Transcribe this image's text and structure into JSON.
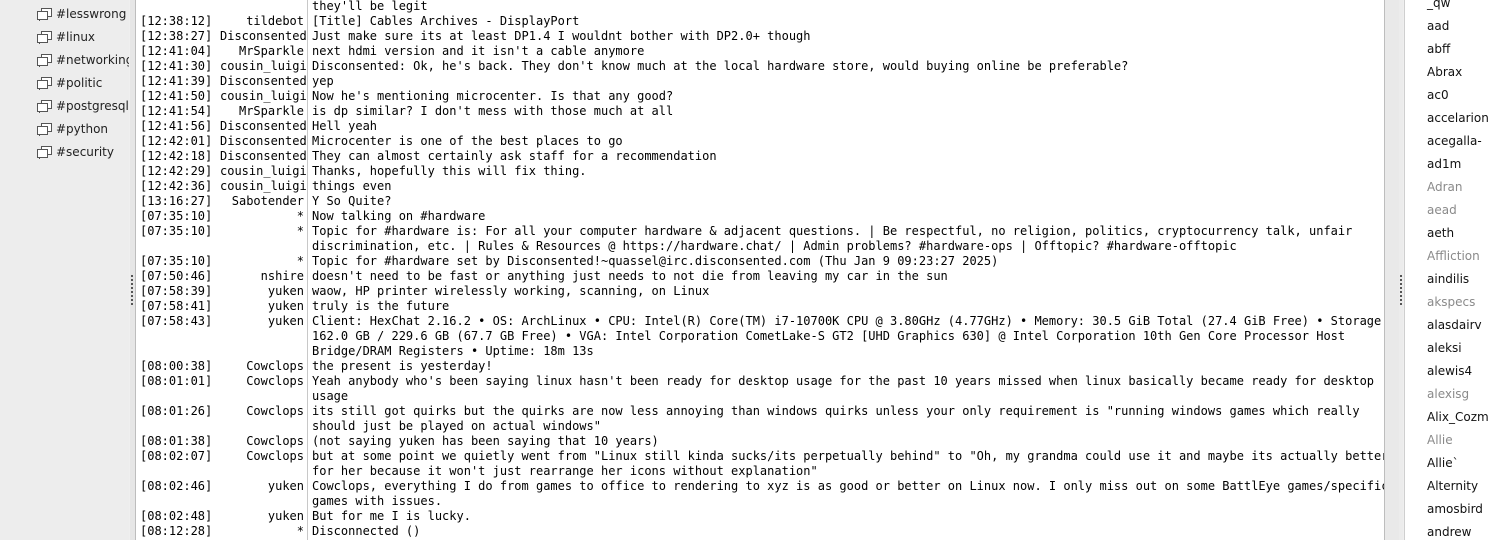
{
  "sidebar": {
    "channels": [
      {
        "name": "#lesswrong"
      },
      {
        "name": "#linux"
      },
      {
        "name": "#networking"
      },
      {
        "name": "#politic"
      },
      {
        "name": "#postgresql"
      },
      {
        "name": "#python"
      },
      {
        "name": "#security"
      }
    ]
  },
  "chat": {
    "lines": [
      {
        "time": "",
        "nick": "",
        "lines": [
          "they'll be legit"
        ]
      },
      {
        "time": "[12:38:12]",
        "nick": "tildebot",
        "lines": [
          "[Title] Cables Archives - DisplayPort"
        ]
      },
      {
        "time": "[12:38:27]",
        "nick": "Disconsented",
        "lines": [
          "Just make sure its at least DP1.4 I wouldnt bother with DP2.0+ though"
        ]
      },
      {
        "time": "[12:41:04]",
        "nick": "MrSparkle",
        "lines": [
          "next hdmi version and it isn't a cable anymore"
        ]
      },
      {
        "time": "[12:41:30]",
        "nick": "cousin_luigi",
        "lines": [
          "Disconsented: Ok, he's back. They don't know much at the local hardware store, would buying online be preferable?"
        ]
      },
      {
        "time": "[12:41:39]",
        "nick": "Disconsented",
        "lines": [
          "yep"
        ]
      },
      {
        "time": "[12:41:50]",
        "nick": "cousin_luigi",
        "lines": [
          "Now he's mentioning microcenter. Is that any good?"
        ]
      },
      {
        "time": "[12:41:54]",
        "nick": "MrSparkle",
        "lines": [
          "is dp similar? I don't mess with those much at all"
        ]
      },
      {
        "time": "[12:41:56]",
        "nick": "Disconsented",
        "lines": [
          "Hell yeah"
        ]
      },
      {
        "time": "[12:42:01]",
        "nick": "Disconsented",
        "lines": [
          "Microcenter is one of the best places to go"
        ]
      },
      {
        "time": "[12:42:18]",
        "nick": "Disconsented",
        "lines": [
          "They can almost certainly ask staff for a recommendation"
        ]
      },
      {
        "time": "[12:42:29]",
        "nick": "cousin_luigi",
        "lines": [
          "Thanks, hopefully this will fix thing."
        ]
      },
      {
        "time": "[12:42:36]",
        "nick": "cousin_luigi",
        "lines": [
          "things even"
        ]
      },
      {
        "time": "[13:16:27]",
        "nick": "Sabotender",
        "lines": [
          "Y So Quite?"
        ]
      },
      {
        "time": "[07:35:10]",
        "nick": "*",
        "lines": [
          "Now talking on #hardware"
        ]
      },
      {
        "time": "[07:35:10]",
        "nick": "*",
        "lines": [
          "Topic for #hardware is: For all your computer hardware & adjacent questions. | Be respectful, no religion, politics, cryptocurrency talk, unfair",
          "discrimination, etc. | Rules & Resources @ https://hardware.chat/ | Admin problems? #hardware-ops | Offtopic? #hardware-offtopic"
        ]
      },
      {
        "time": "[07:35:10]",
        "nick": "*",
        "lines": [
          "Topic for #hardware set by Disconsented!~quassel@irc.disconsented.com (Thu Jan  9 09:23:27 2025)"
        ]
      },
      {
        "time": "[07:50:46]",
        "nick": "nshire",
        "lines": [
          "doesn't need to be fast or anything just needs to not die from leaving my car in the sun"
        ]
      },
      {
        "time": "[07:58:39]",
        "nick": "yuken",
        "lines": [
          "waow, HP printer wirelessly working, scanning, on Linux"
        ]
      },
      {
        "time": "[07:58:41]",
        "nick": "yuken",
        "lines": [
          "truly is the future"
        ]
      },
      {
        "time": "[07:58:43]",
        "nick": "yuken",
        "lines": [
          "Client: HexChat 2.16.2 • OS: ArchLinux • CPU: Intel(R) Core(TM) i7-10700K CPU @ 3.80GHz (4.77GHz) • Memory: 30.5 GiB Total (27.4 GiB Free) • Storage:",
          "162.0 GB / 229.6 GB (67.7 GB Free) • VGA: Intel Corporation CometLake-S GT2 [UHD Graphics 630] @ Intel Corporation 10th Gen Core Processor Host",
          "Bridge/DRAM Registers • Uptime: 18m 13s"
        ]
      },
      {
        "time": "[08:00:38]",
        "nick": "Cowclops",
        "lines": [
          "the present is yesterday!"
        ]
      },
      {
        "time": "[08:01:01]",
        "nick": "Cowclops",
        "lines": [
          "Yeah anybody who's been saying linux hasn't been ready for desktop usage for the past 10 years missed when linux basically became ready for desktop",
          "usage"
        ]
      },
      {
        "time": "[08:01:26]",
        "nick": "Cowclops",
        "lines": [
          "its still got quirks but the quirks are now less annoying than windows quirks unless your only requirement is \"running windows games which really",
          "should just be played on actual windows\""
        ]
      },
      {
        "time": "[08:01:38]",
        "nick": "Cowclops",
        "lines": [
          "(not saying yuken has been saying that 10 years)"
        ]
      },
      {
        "time": "[08:02:07]",
        "nick": "Cowclops",
        "lines": [
          "but at some point we quietly went from \"Linux still kinda sucks/its perpetually behind\" to \"Oh, my grandma could use it and maybe its actually better",
          "for her because it won't just rearrange her icons without explanation\""
        ]
      },
      {
        "time": "[08:02:46]",
        "nick": "yuken",
        "lines": [
          "Cowclops, everything I do from games to office to rendering to xyz is as good or better on Linux now. I only miss out on some BattlEye games/specificx",
          "games with issues."
        ]
      },
      {
        "time": "[08:02:48]",
        "nick": "yuken",
        "lines": [
          "But for me I is lucky."
        ]
      },
      {
        "time": "[08:12:28]",
        "nick": "*",
        "lines": [
          "Disconnected ()"
        ]
      }
    ]
  },
  "userlist": {
    "users": [
      {
        "name": "_qw",
        "away": false
      },
      {
        "name": "aad",
        "away": false
      },
      {
        "name": "abff",
        "away": false
      },
      {
        "name": "Abrax",
        "away": false
      },
      {
        "name": "ac0",
        "away": false
      },
      {
        "name": "accelarion",
        "away": false
      },
      {
        "name": "acegalla-",
        "away": false
      },
      {
        "name": "ad1m",
        "away": false
      },
      {
        "name": "Adran",
        "away": true
      },
      {
        "name": "aead",
        "away": true
      },
      {
        "name": "aeth",
        "away": false
      },
      {
        "name": "Affliction",
        "away": true
      },
      {
        "name": "aindilis",
        "away": false
      },
      {
        "name": "akspecs",
        "away": true
      },
      {
        "name": "alasdairv",
        "away": false
      },
      {
        "name": "aleksi",
        "away": false
      },
      {
        "name": "alewis4",
        "away": false
      },
      {
        "name": "alexisg",
        "away": true
      },
      {
        "name": "Alix_Cozm",
        "away": false
      },
      {
        "name": "Allie",
        "away": true
      },
      {
        "name": "Allie`",
        "away": false
      },
      {
        "name": "Alternity",
        "away": false
      },
      {
        "name": "amosbird",
        "away": false
      },
      {
        "name": "andrew",
        "away": false
      }
    ]
  },
  "colors": {
    "away_nick": "#8a8a8a",
    "active_nick": "#111111",
    "chat_bg": "#ffffff",
    "panel_bg": "#ededed"
  },
  "icons": {
    "channel": "channel-icon"
  }
}
